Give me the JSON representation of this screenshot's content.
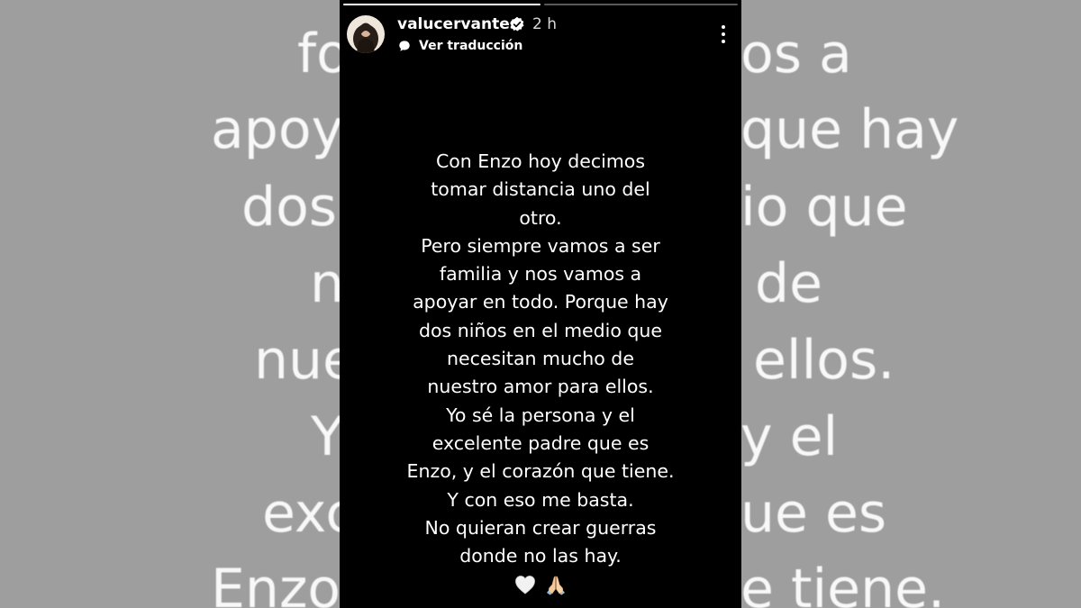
{
  "background_text": {
    "lines": [
      "fo",
      "os a",
      "apoy",
      "que hay",
      "dos",
      "io que",
      "n",
      "de",
      "nue",
      "ellos.",
      "Y",
      "y el",
      "exc",
      "ue es",
      "Enzo,",
      "e tiene."
    ]
  },
  "story": {
    "username": "valucervantes",
    "time": "2 h",
    "translate_label": "Ver traducción",
    "text_lines": [
      "Con Enzo hoy decimos",
      "tomar distancia uno del",
      "otro.",
      "Pero siempre vamos a ser",
      "familia y nos vamos a",
      "apoyar en todo. Porque hay",
      "dos niños en el medio que",
      "necesitan mucho de",
      "nuestro amor para ellos.",
      "Yo sé la persona y el",
      "excelente padre que es",
      "Enzo, y el corazón que tiene.",
      "Y con eso me basta.",
      "No quieran crear guerras",
      "donde no las hay."
    ],
    "emojis": [
      "white-heart-icon",
      "folded-hands-icon"
    ],
    "progress_segments": [
      {
        "state": "done"
      },
      {
        "state": "active"
      }
    ]
  },
  "colors": {
    "background": "#9e9e9e",
    "panel": "#000000",
    "text": "#ffffff",
    "verified": "#ffffff"
  }
}
